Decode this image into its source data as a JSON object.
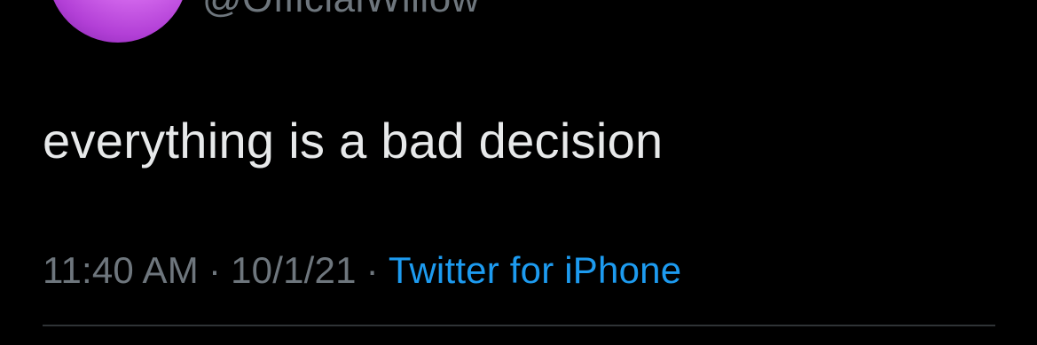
{
  "tweet": {
    "handle": "@OfficialWillow",
    "text": "everything is a bad decision",
    "time": "11:40 AM",
    "date": "10/1/21",
    "separator": "·",
    "source": "Twitter for iPhone"
  },
  "colors": {
    "background": "#000000",
    "text": "#e7e9ea",
    "secondary": "#6e767d",
    "link": "#1d9bf0",
    "divider": "#2f3336",
    "avatar_accent": "#d86ef0"
  }
}
